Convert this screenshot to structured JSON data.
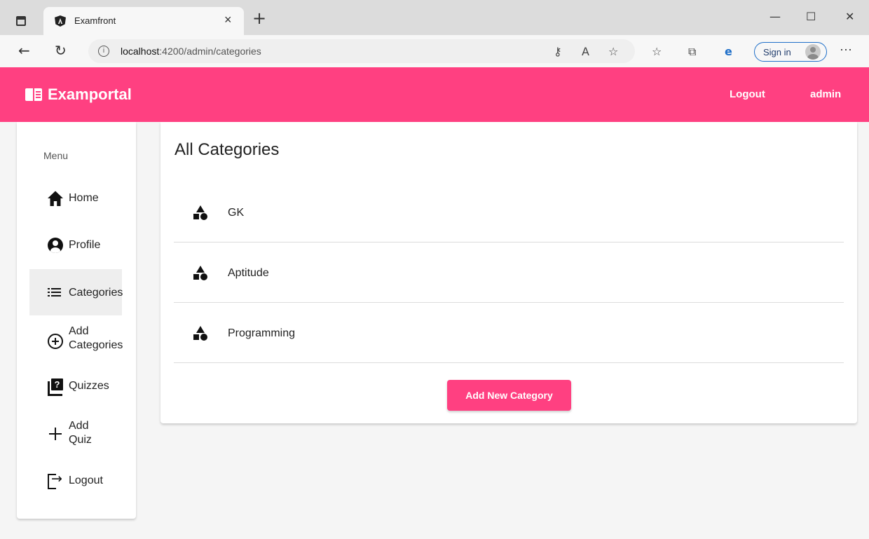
{
  "browser": {
    "tab_title": "Examfront",
    "tab_close": "×",
    "new_tab": "+",
    "window_controls": {
      "minimize": "—",
      "maximize": "☐",
      "close": "✕"
    },
    "url_host": "localhost",
    "url_path": ":4200/admin/categories",
    "signin_label": "Sign in",
    "more": "···",
    "icons": [
      "tab-actions-icon",
      "angular-favicon",
      "back-icon",
      "refresh-icon",
      "info-icon",
      "key-icon",
      "read-aloud-icon",
      "add-favorite-icon",
      "favorites-icon",
      "collections-icon",
      "ie-mode-icon",
      "profile-avatar-icon"
    ]
  },
  "app": {
    "brand": "Examportal",
    "brand_icon": "menu-book-icon",
    "header_links": {
      "logout": "Logout",
      "user": "admin"
    },
    "accent_color": "#ff4081"
  },
  "sidebar": {
    "menu_header": "Menu",
    "items": [
      {
        "label": "Home",
        "icon": "home-icon",
        "active": false
      },
      {
        "label": "Profile",
        "icon": "account-circle-icon",
        "active": false
      },
      {
        "label": "Categories",
        "icon": "list-icon",
        "active": true
      },
      {
        "label": "Add Categories",
        "label_line1": "Add",
        "label_line2": "Categories",
        "icon": "add-circle-icon",
        "active": false
      },
      {
        "label": "Quizzes",
        "icon": "quiz-icon",
        "active": false
      },
      {
        "label": "Add Quiz",
        "label_line1": "Add",
        "label_line2": "Quiz",
        "icon": "add-icon",
        "active": false
      },
      {
        "label": "Logout",
        "icon": "logout-icon",
        "active": false
      }
    ]
  },
  "main": {
    "title": "All Categories",
    "categories": [
      {
        "title": "GK",
        "icon": "category-icon"
      },
      {
        "title": "Aptitude",
        "icon": "category-icon"
      },
      {
        "title": "Programming",
        "icon": "category-icon"
      }
    ],
    "add_button": "Add New Category"
  }
}
